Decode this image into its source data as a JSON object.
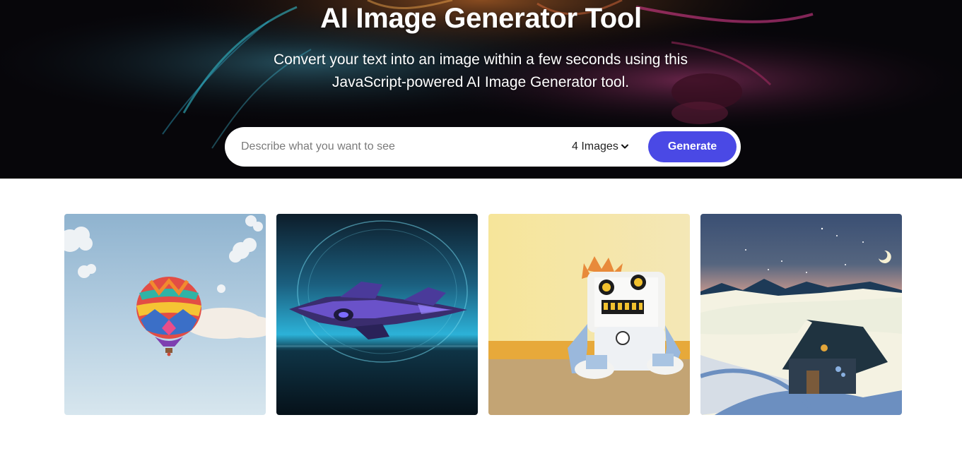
{
  "hero": {
    "title": "AI Image Generator Tool",
    "subtitle_line1": "Convert your text into an image within a few seconds using this",
    "subtitle_line2": "JavaScript-powered AI Image Generator tool."
  },
  "form": {
    "placeholder": "Describe what you want to see",
    "value": "",
    "quantity_selected": "4 Images",
    "generate_label": "Generate"
  },
  "gallery": {
    "images": [
      {
        "subject": "hot air balloon in blue sky"
      },
      {
        "subject": "purple spaceship over water"
      },
      {
        "subject": "stuffed robot toy against yellow wall"
      },
      {
        "subject": "snowy hut under night sky with moon"
      }
    ]
  },
  "colors": {
    "accent": "#4a49e5",
    "hero_background": "#07060a",
    "page_background": "#ffffff"
  }
}
